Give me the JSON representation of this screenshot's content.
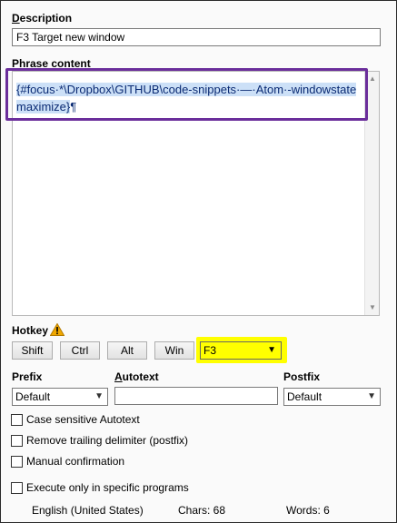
{
  "description": {
    "label_prefix": "D",
    "label_rest": "escription",
    "value": "F3 Target new window"
  },
  "phrase": {
    "label": "Phrase content",
    "content_line1": "{#focus·*\\Dropbox\\GITHUB\\code-snippets·—·Atom·-windowstate",
    "content_line2": "maximize}",
    "paragraph_mark": "¶"
  },
  "hotkey": {
    "label": "Hotkey",
    "buttons": [
      "Shift",
      "Ctrl",
      "Alt",
      "Win"
    ],
    "key_value": "F3",
    "warning_icon": "warning-icon"
  },
  "prefix": {
    "label": "Prefix",
    "value": "Default"
  },
  "autotext": {
    "label_prefix": "A",
    "label_rest": "utotext",
    "value": ""
  },
  "postfix": {
    "label": "Postfix",
    "value": "Default"
  },
  "options": [
    {
      "label": "Case sensitive Autotext",
      "checked": false
    },
    {
      "label": "Remove trailing delimiter (postfix)",
      "checked": false
    },
    {
      "label": "Manual confirmation",
      "checked": false
    },
    {
      "label": "Execute only in specific programs",
      "checked": false
    }
  ],
  "status": {
    "language": "English (United States)",
    "chars": "Chars: 68",
    "words": "Words: 6"
  },
  "colors": {
    "highlight_border": "#6b2e9b",
    "hotkey_highlight": "#ffff00",
    "selection": "#cce0f7"
  }
}
